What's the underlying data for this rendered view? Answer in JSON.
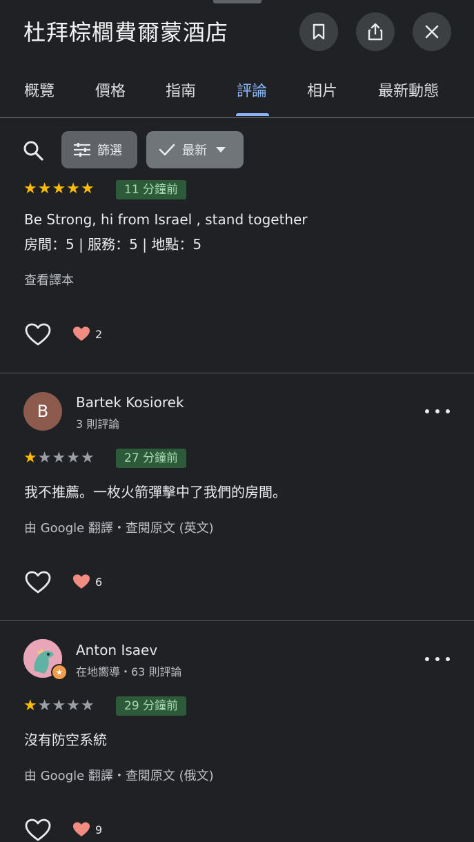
{
  "header": {
    "title": "杜拜棕櫚費爾蒙酒店",
    "actions": [
      {
        "icon": "bookmark-icon"
      },
      {
        "icon": "share-icon"
      },
      {
        "icon": "close-icon"
      }
    ]
  },
  "tabs": [
    {
      "label": "概覽"
    },
    {
      "label": "價格"
    },
    {
      "label": "指南"
    },
    {
      "label": "評論",
      "active": true
    },
    {
      "label": "相片"
    },
    {
      "label": "最新動態"
    }
  ],
  "toolbar": {
    "filter_label": "篩選",
    "sort_label": "最新"
  },
  "colors": {
    "background": "#202124",
    "accent": "#8ab4f8",
    "star": "#fbbc04",
    "time_badge_bg": "#2d5a38",
    "time_badge_text": "#a8dab5"
  },
  "reviews": [
    {
      "rating": 5,
      "time": "11 分鐘前",
      "text": "Be Strong, hi from Israel , stand together",
      "detail": "房間：5 | 服務：5 | 地點：5",
      "translate_link": "查看譯本",
      "reaction_count": "2"
    },
    {
      "author": "Bartek Kosiorek",
      "avatar_letter": "B",
      "meta": "3 則評論",
      "rating": 1,
      "time": "27 分鐘前",
      "text": "我不推薦。一枚火箭彈擊中了我們的房間。",
      "translation_note": "由 Google 翻譯・查閱原文 (英文)",
      "reaction_count": "6"
    },
    {
      "author": "Anton Isaev",
      "meta": "在地嚮導・63 則評論",
      "rating": 1,
      "time": "29 分鐘前",
      "text": "沒有防空系統",
      "translation_note": "由 Google 翻譯・查閱原文 (俄文)",
      "reaction_count": "9"
    }
  ]
}
